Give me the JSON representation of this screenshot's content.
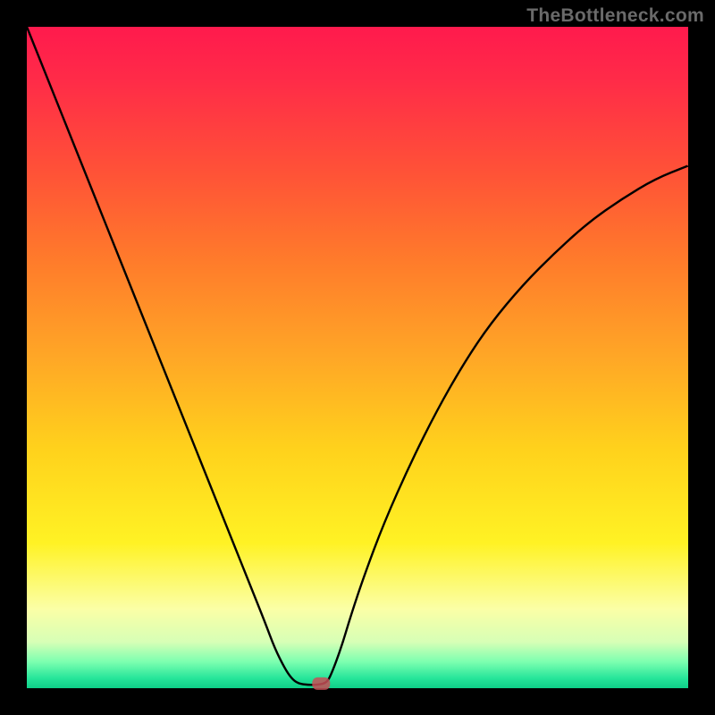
{
  "watermark": "TheBottleneck.com",
  "chart_data": {
    "type": "line",
    "title": "",
    "xlabel": "",
    "ylabel": "",
    "xlim": [
      0,
      100
    ],
    "ylim": [
      0,
      100
    ],
    "grid": false,
    "curve_points": [
      {
        "x": 0,
        "y": 100
      },
      {
        "x": 4,
        "y": 90
      },
      {
        "x": 8,
        "y": 80
      },
      {
        "x": 12,
        "y": 70
      },
      {
        "x": 16,
        "y": 60
      },
      {
        "x": 20,
        "y": 50
      },
      {
        "x": 24,
        "y": 40
      },
      {
        "x": 28,
        "y": 30
      },
      {
        "x": 30,
        "y": 25
      },
      {
        "x": 32,
        "y": 20
      },
      {
        "x": 34,
        "y": 15
      },
      {
        "x": 36,
        "y": 10
      },
      {
        "x": 37.5,
        "y": 6
      },
      {
        "x": 39,
        "y": 3
      },
      {
        "x": 40,
        "y": 1.5
      },
      {
        "x": 41,
        "y": 0.7
      },
      {
        "x": 42.5,
        "y": 0.5
      },
      {
        "x": 44,
        "y": 0.5
      },
      {
        "x": 45.3,
        "y": 0.8
      },
      {
        "x": 46,
        "y": 2
      },
      {
        "x": 47.5,
        "y": 6
      },
      {
        "x": 49,
        "y": 11
      },
      {
        "x": 51,
        "y": 17
      },
      {
        "x": 54,
        "y": 25
      },
      {
        "x": 58,
        "y": 34
      },
      {
        "x": 62,
        "y": 42
      },
      {
        "x": 66,
        "y": 49
      },
      {
        "x": 70,
        "y": 55
      },
      {
        "x": 75,
        "y": 61
      },
      {
        "x": 80,
        "y": 66
      },
      {
        "x": 85,
        "y": 70.5
      },
      {
        "x": 90,
        "y": 74
      },
      {
        "x": 95,
        "y": 77
      },
      {
        "x": 100,
        "y": 79
      }
    ],
    "marker": {
      "x": 44.5,
      "y": 0.7,
      "shape": "rounded-rect"
    },
    "background": "gradient-red-yellow-green",
    "gradient_stops": [
      {
        "pos": 0,
        "color": "#ff1a4d"
      },
      {
        "pos": 0.5,
        "color": "#ffd21c"
      },
      {
        "pos": 0.88,
        "color": "#fbffa6"
      },
      {
        "pos": 1,
        "color": "#0ecf88"
      }
    ]
  }
}
